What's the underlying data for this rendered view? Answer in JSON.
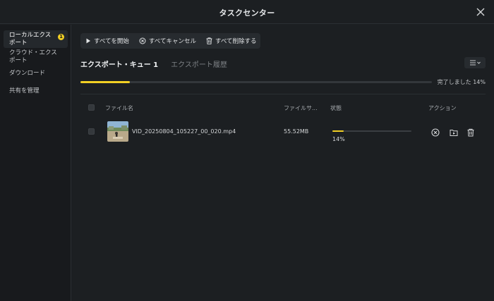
{
  "window": {
    "title": "タスクセンター"
  },
  "sidebar": {
    "items": [
      {
        "label": "ローカルエクスポート",
        "badge": "1"
      },
      {
        "label": "クラウド・エクスポート"
      },
      {
        "label": "ダウンロード"
      },
      {
        "label": "共有を管理"
      }
    ]
  },
  "toolbar": {
    "start_all": "すべてを開始",
    "cancel_all": "すべてキャンセル",
    "delete_all": "すべて削除する"
  },
  "tabs": [
    {
      "label": "エクスポート・キュー 1",
      "active": true
    },
    {
      "label": "エクスポート履歴",
      "active": false
    }
  ],
  "overall": {
    "text": "完了しました 14%",
    "progress": 0.14
  },
  "table": {
    "headers": {
      "name": "ファイル名",
      "size": "ファイルサ...",
      "status": "状態",
      "actions": "アクション"
    },
    "rows": [
      {
        "name": "VID_20250804_105227_00_020.mp4",
        "size": "55.52MB",
        "progress_text": "14%",
        "progress": 0.14
      }
    ]
  },
  "colors": {
    "accent": "#f2d024",
    "background": "#1c1f22",
    "sidebar": "#181a1d"
  },
  "icons": [
    "close-icon",
    "play-icon",
    "cancel-circle-icon",
    "trash-icon",
    "sort-icon",
    "folder-play-icon"
  ]
}
